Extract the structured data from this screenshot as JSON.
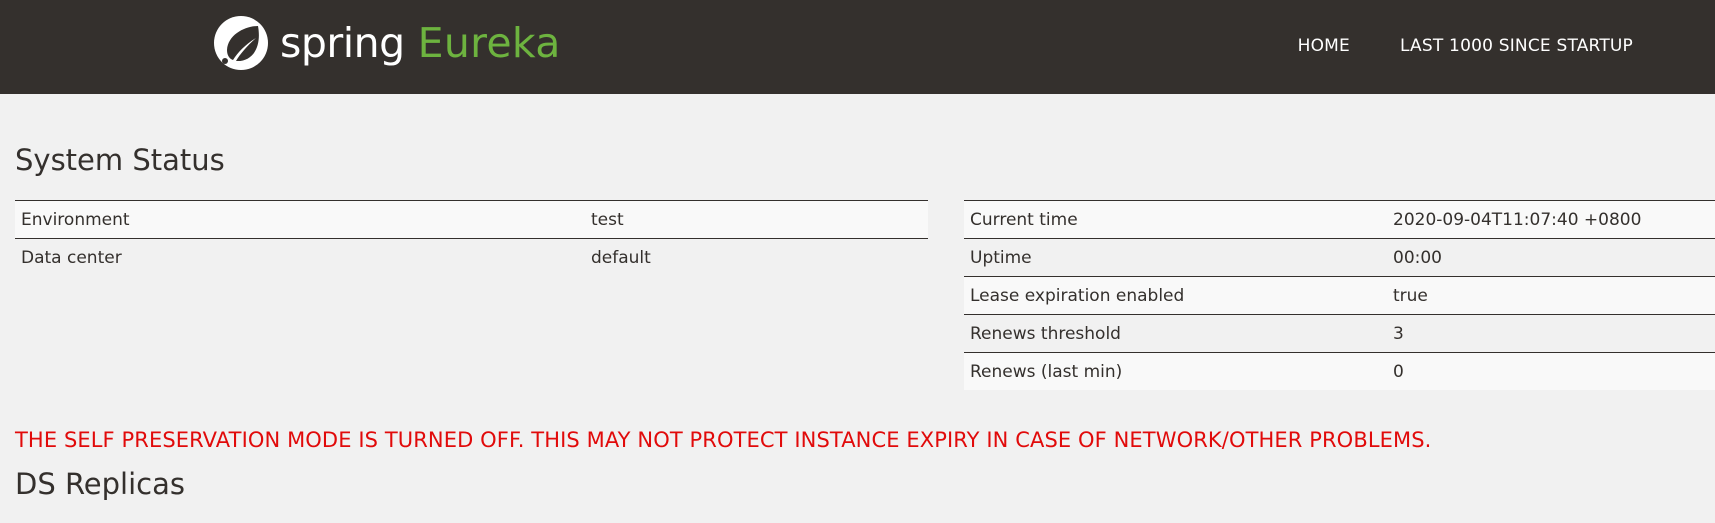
{
  "navbar": {
    "brand_spring": "spring",
    "brand_eureka": "Eureka",
    "links": [
      {
        "label": "HOME"
      },
      {
        "label": "LAST 1000 SINCE STARTUP"
      }
    ]
  },
  "system_status": {
    "title": "System Status",
    "left_table": [
      {
        "key": "Environment",
        "value": "test"
      },
      {
        "key": "Data center",
        "value": "default"
      }
    ],
    "right_table": [
      {
        "key": "Current time",
        "value": "2020-09-04T11:07:40 +0800"
      },
      {
        "key": "Uptime",
        "value": "00:00"
      },
      {
        "key": "Lease expiration enabled",
        "value": "true"
      },
      {
        "key": "Renews threshold",
        "value": "3"
      },
      {
        "key": "Renews (last min)",
        "value": "0"
      }
    ]
  },
  "warning": "THE SELF PRESERVATION MODE IS TURNED OFF. THIS MAY NOT PROTECT INSTANCE EXPIRY IN CASE OF NETWORK/OTHER PROBLEMS.",
  "ds_replicas": {
    "title": "DS Replicas"
  },
  "colors": {
    "navbar_bg": "#34302d",
    "brand_green": "#6db33f",
    "warning_red": "#e10a0a",
    "page_bg": "#f1f1f1"
  }
}
